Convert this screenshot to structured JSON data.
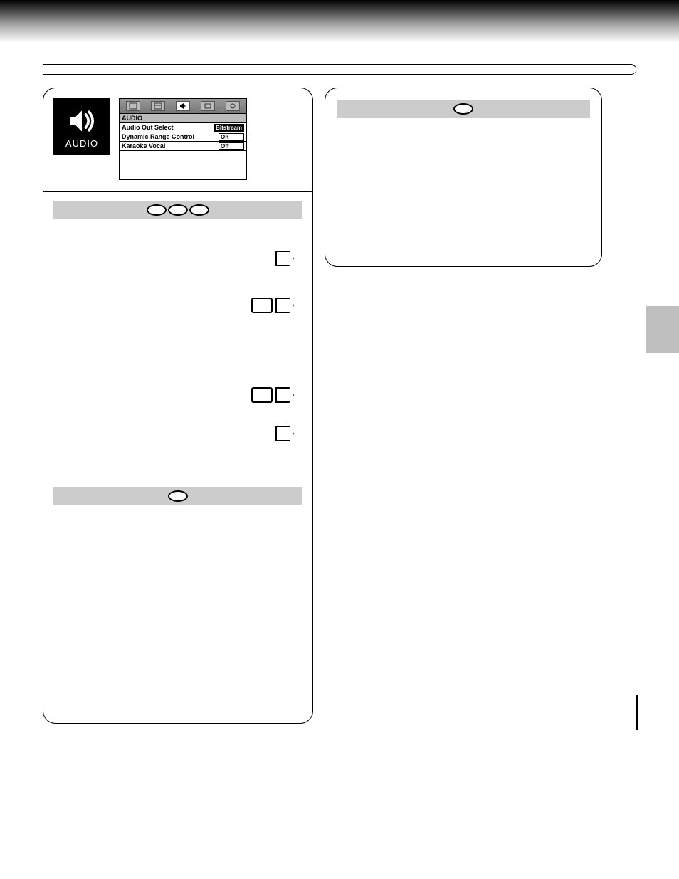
{
  "header": {
    "audio_label": "AUDIO"
  },
  "osd": {
    "title": "AUDIO",
    "rows": [
      {
        "label": "Audio Out Select",
        "value": "Bitstream",
        "highlighted": true
      },
      {
        "label": "Dynamic Range Control",
        "value": "On",
        "highlighted": false
      },
      {
        "label": "Karaoke Vocal",
        "value": "Off",
        "highlighted": false
      }
    ]
  }
}
